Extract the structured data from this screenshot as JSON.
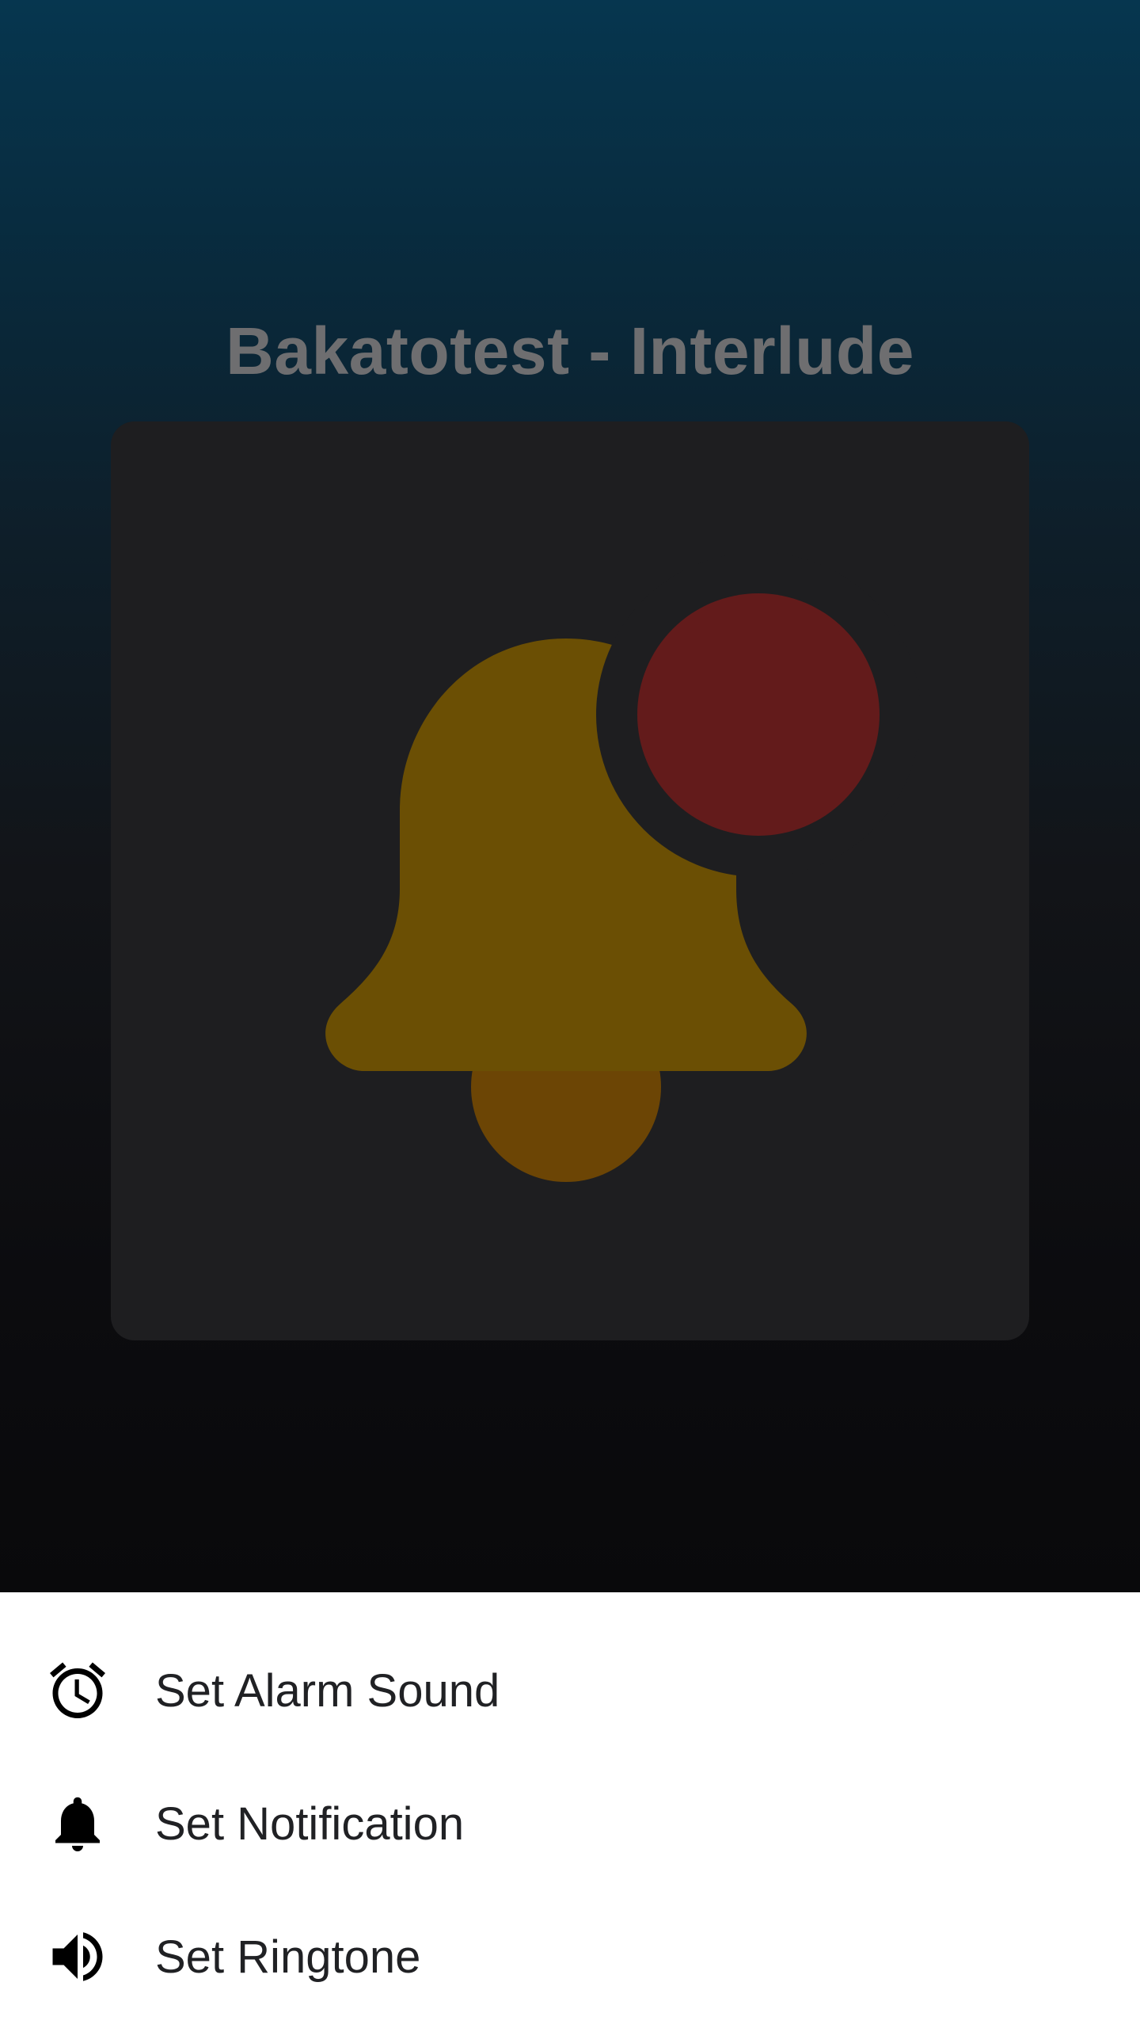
{
  "sound": {
    "title": "Bakatotest - Interlude"
  },
  "menu": {
    "items": [
      {
        "label": "Set Alarm Sound",
        "icon": "alarm-clock-icon"
      },
      {
        "label": "Set Notification",
        "icon": "bell-icon"
      },
      {
        "label": "Set Ringtone",
        "icon": "speaker-icon"
      }
    ]
  },
  "colors": {
    "sheet_background": "#ffffff",
    "card_background": "#1e1e20",
    "bell_body": "#6b4f04",
    "bell_clapper": "#6c4505",
    "notification_dot": "#631b1b",
    "title_text": "#6e6e70",
    "menu_text": "#202124",
    "menu_icon": "#000000"
  }
}
